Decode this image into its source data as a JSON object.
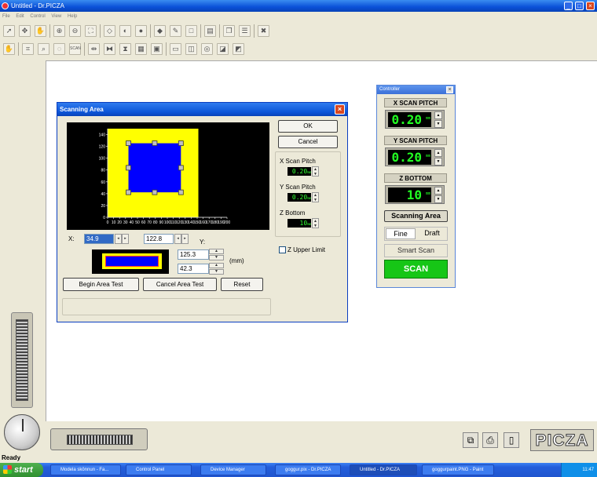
{
  "window": {
    "title": "Untitled - Dr.PICZA"
  },
  "menu": [
    "File",
    "Edit",
    "Control",
    "View",
    "Help"
  ],
  "status": {
    "text": "Ready"
  },
  "scanning_dialog": {
    "title": "Scanning Area",
    "ok_label": "OK",
    "cancel_label": "Cancel",
    "x_scan_pitch_label": "X Scan Pitch",
    "x_scan_pitch_value": "0.20",
    "y_scan_pitch_label": "Y Scan Pitch",
    "y_scan_pitch_value": "0.20",
    "z_bottom_label": "Z Bottom",
    "z_bottom_value": "10",
    "unit_mm": "mm",
    "x_label": "X:",
    "x_from": "34.9",
    "x_to": "122.8",
    "y_label": "Y:",
    "y_from": "125.3",
    "y_to": "42.3",
    "mm_label": "(mm)",
    "z_upper_limit_label": "Z Upper Limit",
    "z_upper_limit_checked": false,
    "begin_area_test_label": "Begin Area Test",
    "cancel_area_test_label": "Cancel Area Test",
    "reset_label": "Reset",
    "plot": {
      "y_ticks": [
        "0",
        "20",
        "40",
        "60",
        "80",
        "100",
        "120",
        "140"
      ],
      "x_ticks": [
        "0",
        "10",
        "20",
        "30",
        "40",
        "50",
        "60",
        "70",
        "80",
        "90",
        "100",
        "110",
        "120",
        "130",
        "140",
        "150",
        "160",
        "170",
        "180",
        "190",
        "200"
      ],
      "x_max": 200,
      "y_max": 150,
      "table_x_max": 152,
      "selection": {
        "x_from": 34.9,
        "x_to": 122.8,
        "y_from": 42.3,
        "y_to": 125.3
      },
      "colors": {
        "table": "#ffff00",
        "selection": "#0000ff",
        "background": "#000000",
        "handle": "#c0c0c0"
      }
    }
  },
  "controller": {
    "title": "Controller",
    "x_scan_pitch_label": "X SCAN PITCH",
    "x_scan_pitch_value": "0.20",
    "y_scan_pitch_label": "Y SCAN PITCH",
    "y_scan_pitch_value": "0.20",
    "z_bottom_label": "Z BOTTOM",
    "z_bottom_value": "10",
    "unit_mm": "mm",
    "scanning_area_label": "Scanning Area",
    "fine_label": "Fine",
    "draft_label": "Draft",
    "smart_scan_label": "Smart Scan",
    "scan_label": "SCAN",
    "scan_color": "#16c616"
  },
  "brand": {
    "logo_text": "PICZA"
  },
  "taskbar": {
    "start_label": "start",
    "tasks": [
      "Modela skönnun - Fa...",
      "Control Panel",
      "Device Manager",
      "goggur.pix - Dr.PICZA",
      "Untitled - Dr.PICZA",
      "goggurpaint.PNG - Paint"
    ],
    "clock": "11:47"
  },
  "colors": {
    "titlebar": "#0a50d8",
    "taskbar": "#245edb",
    "workspace": "#ffffff"
  }
}
